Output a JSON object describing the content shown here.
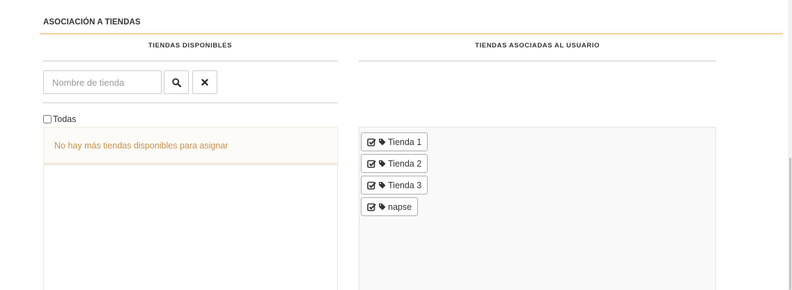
{
  "section": {
    "title": "ASOCIACIÓN A TIENDAS"
  },
  "available": {
    "header": "TIENDAS DISPONIBLES",
    "search": {
      "placeholder": "Nombre de tienda",
      "value": ""
    },
    "search_button_icon": "search-icon",
    "clear_button_icon": "close-icon",
    "select_all_label": "Todas",
    "empty_notice": "No hay más tiendas disponibles para asignar"
  },
  "associated": {
    "header": "TIENDAS ASOCIADAS AL USUARIO",
    "chip_icons": [
      "check-square-icon",
      "tag-icon"
    ],
    "items": [
      {
        "label": "Tienda 1"
      },
      {
        "label": "Tienda 2"
      },
      {
        "label": "Tienda 3"
      },
      {
        "label": "napse"
      }
    ]
  },
  "colors": {
    "accent": "#f0ad4e",
    "notice_text": "#c8904b"
  }
}
